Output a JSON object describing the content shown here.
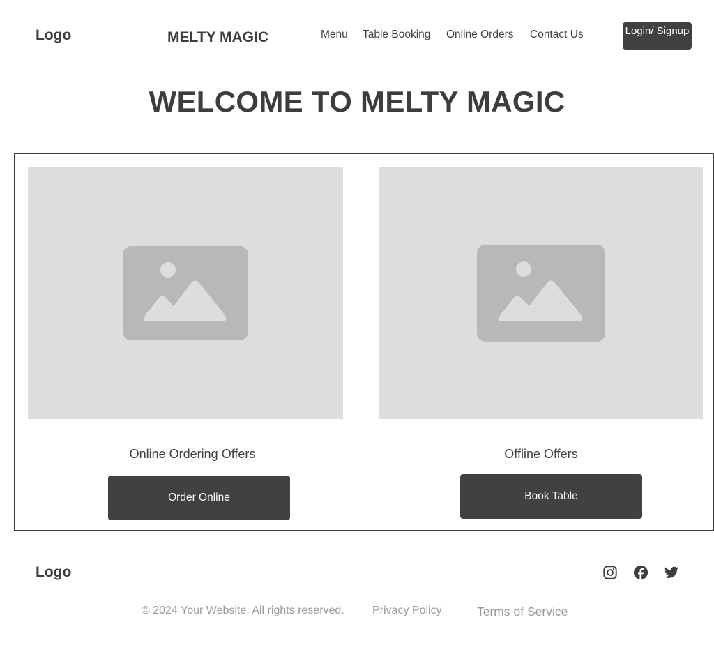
{
  "header": {
    "logo": "Logo",
    "brand": "MELTY MAGIC",
    "nav": [
      "Menu",
      "Table Booking",
      "Online Orders",
      "Contact Us"
    ],
    "login_label": "Login/ Signup"
  },
  "hero": {
    "title": "WELCOME TO MELTY MAGIC"
  },
  "cards": [
    {
      "image_icon": "image-placeholder-icon",
      "title": "Online Ordering Offers",
      "button_label": "Order Online"
    },
    {
      "image_icon": "image-placeholder-icon",
      "title": "Offline Offers",
      "button_label": "Book Table"
    }
  ],
  "footer": {
    "logo": "Logo",
    "social_icons": [
      "instagram-icon",
      "facebook-icon",
      "twitter-icon"
    ],
    "copyright": "© 2024 Your Website. All rights reserved.",
    "privacy_label": "Privacy Policy",
    "terms_label": "Terms of Service"
  },
  "colors": {
    "button_bg": "#414141",
    "placeholder_bg": "#dddddd",
    "placeholder_icon": "#b8b8b8",
    "footer_text": "#9a9a9a"
  }
}
